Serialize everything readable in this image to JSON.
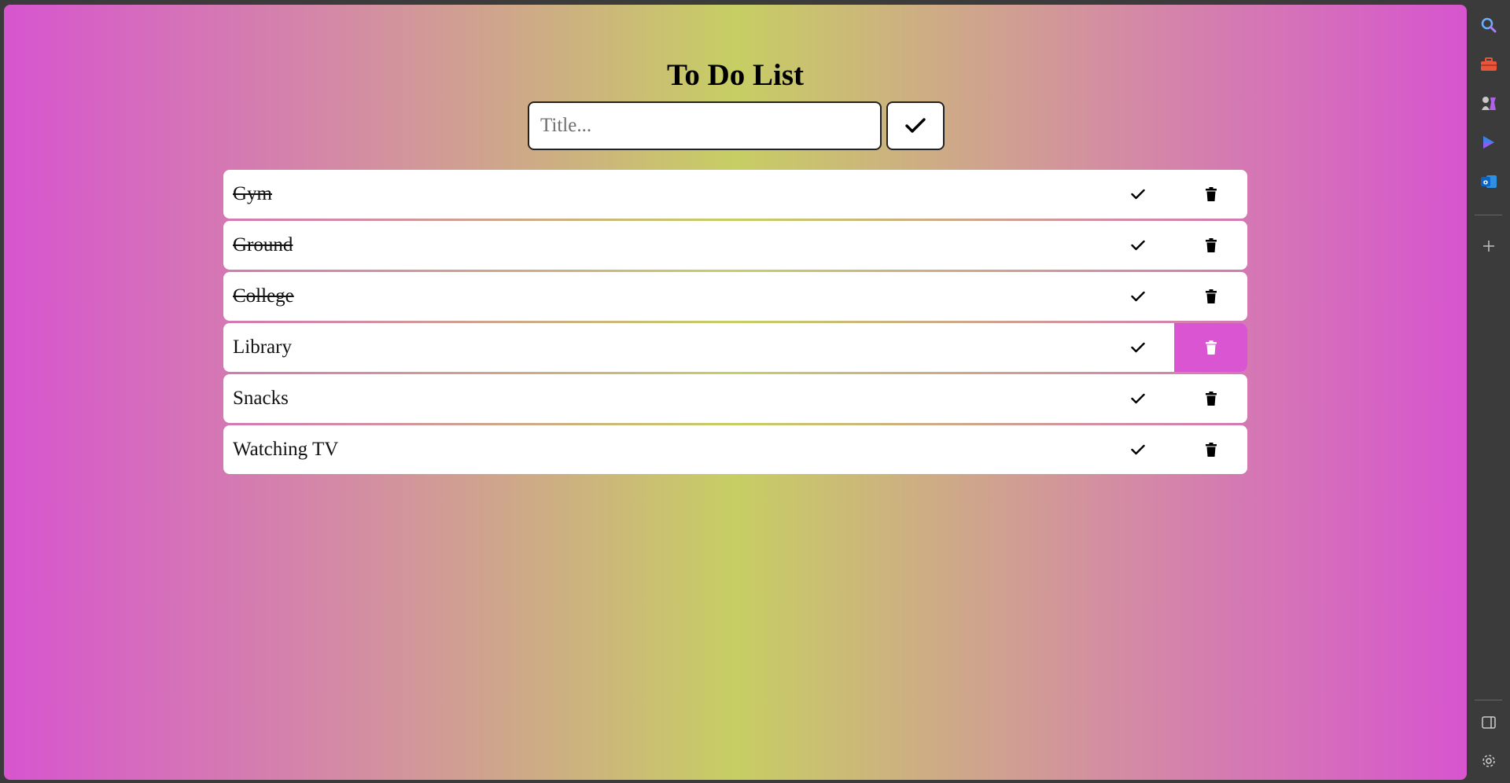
{
  "app": {
    "title": "To Do List",
    "input_placeholder": "Title...",
    "accent_color": "#d955d2"
  },
  "todos": [
    {
      "text": "Gym",
      "completed": true
    },
    {
      "text": "Ground",
      "completed": true
    },
    {
      "text": "College",
      "completed": true
    },
    {
      "text": "Library",
      "completed": false,
      "delete_hovered": true
    },
    {
      "text": "Snacks",
      "completed": false
    },
    {
      "text": "Watching TV",
      "completed": false
    }
  ],
  "sidebar": {
    "icons": [
      "search-icon",
      "toolbox-icon",
      "chess-icon",
      "copilot-icon",
      "outlook-icon",
      "add-icon",
      "split-view-icon",
      "settings-icon"
    ]
  }
}
